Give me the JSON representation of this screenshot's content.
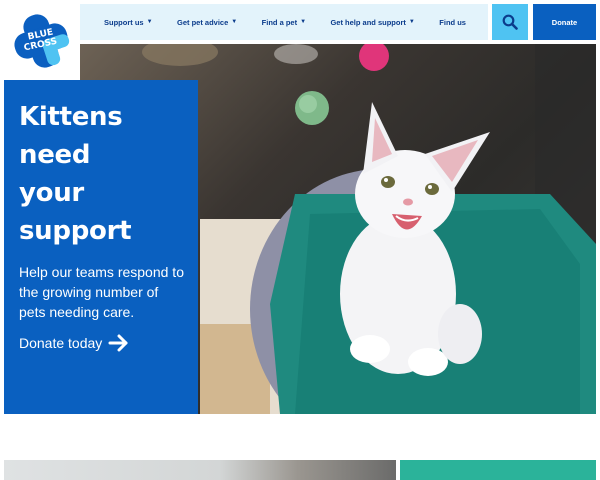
{
  "header": {
    "logo": {
      "line1": "BLUE",
      "line2": "CROSS"
    },
    "nav": [
      {
        "label": "Support us",
        "has_dropdown": true
      },
      {
        "label": "Get pet advice",
        "has_dropdown": true
      },
      {
        "label": "Find a pet",
        "has_dropdown": true
      },
      {
        "label": "Get help and support",
        "has_dropdown": true
      },
      {
        "label": "Find us",
        "has_dropdown": false
      }
    ],
    "search_icon": "search-icon",
    "donate_label": "Donate"
  },
  "hero": {
    "title_line1": "Kittens need",
    "title_line2": "your support",
    "body": "Help our teams respond to the growing number of pets needing care.",
    "link_label": "Donate today",
    "link_icon": "arrow-right-icon",
    "image_subject": "white kitten sitting on a teal blanket"
  },
  "colors": {
    "brand_blue": "#0a60c0",
    "navy_text": "#0b3c8c",
    "nav_bg": "#e3f3fb",
    "search_bg": "#4fc3f2",
    "teal": "#2bb39a"
  }
}
